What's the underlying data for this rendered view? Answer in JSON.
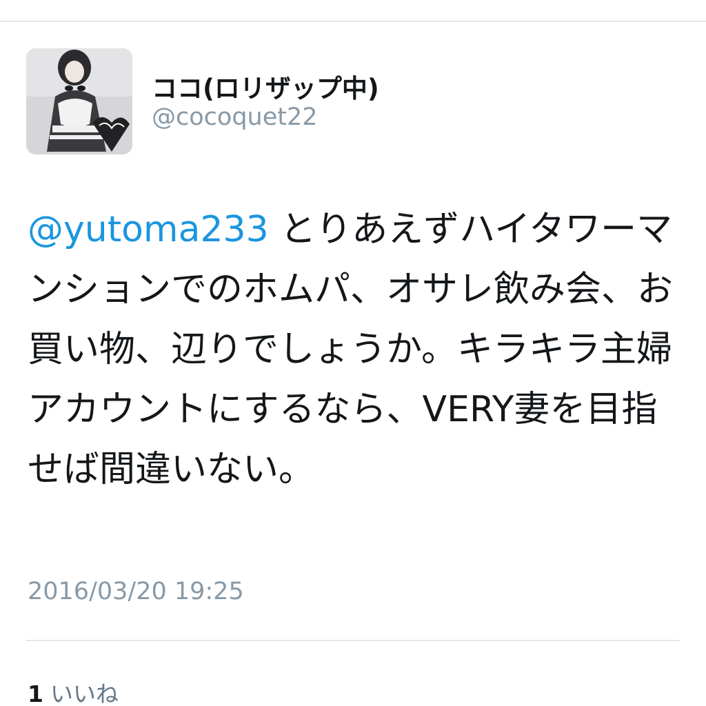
{
  "user": {
    "display_name": "ココ(ロリザップ中)",
    "handle": "@cocoquet22"
  },
  "tweet": {
    "mention": "@yutoma233",
    "text": " とりあえずハイタワーマンションでのホムパ、オサレ飲み会、お買い物、辺りでしょうか。キラキラ主婦アカウントにするなら、VERY妻を目指せば間違いない。",
    "timestamp": "2016/03/20 19:25"
  },
  "stats": {
    "likes_count": "1",
    "likes_label": "いいね"
  },
  "colors": {
    "mention": "#1b95e0",
    "secondary_text": "#8899a6",
    "divider": "#e1e8ed"
  }
}
